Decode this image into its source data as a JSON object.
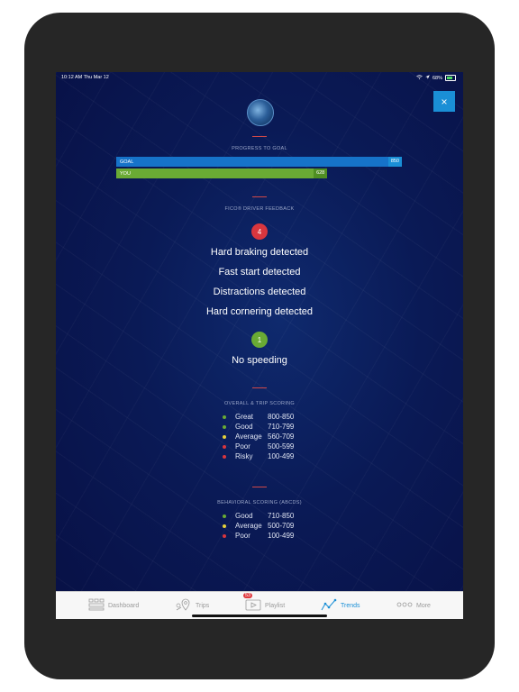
{
  "status_bar": {
    "time": "10:12 AM  Thu Mar 12",
    "battery": "68%"
  },
  "header": {
    "close_label": "×"
  },
  "progress": {
    "title": "PROGRESS TO GOAL",
    "goal_label": "GOAL",
    "goal_value": "850",
    "you_label": "YOU",
    "you_value": "628",
    "you_fraction": 0.739
  },
  "feedback": {
    "title": "FICO® DRIVER FEEDBACK",
    "negative_count": "4",
    "negative_items": [
      "Hard braking detected",
      "Fast start detected",
      "Distractions detected",
      "Hard cornering detected"
    ],
    "positive_count": "1",
    "positive_items": [
      "No speeding"
    ]
  },
  "overall_scoring": {
    "title": "OVERALL & TRIP SCORING",
    "rows": [
      {
        "name": "Great",
        "range": "800-850",
        "color": "#6aab34"
      },
      {
        "name": "Good",
        "range": "710-799",
        "color": "#6aab34"
      },
      {
        "name": "Average",
        "range": "560-709",
        "color": "#e6d23a"
      },
      {
        "name": "Poor",
        "range": "500-599",
        "color": "#d9363e"
      },
      {
        "name": "Risky",
        "range": "100-499",
        "color": "#d9363e"
      }
    ]
  },
  "behavioral_scoring": {
    "title": "BEHAVIORAL SCORING (ABCDS)",
    "rows": [
      {
        "name": "Good",
        "range": "710-850",
        "color": "#6aab34"
      },
      {
        "name": "Average",
        "range": "500-709",
        "color": "#e6d23a"
      },
      {
        "name": "Poor",
        "range": "100-499",
        "color": "#d9363e"
      }
    ]
  },
  "tabbar": {
    "dashboard": "Dashboard",
    "trips": "Trips",
    "playlist": "Playlist",
    "playlist_badge": "53",
    "trends": "Trends",
    "more": "More"
  }
}
